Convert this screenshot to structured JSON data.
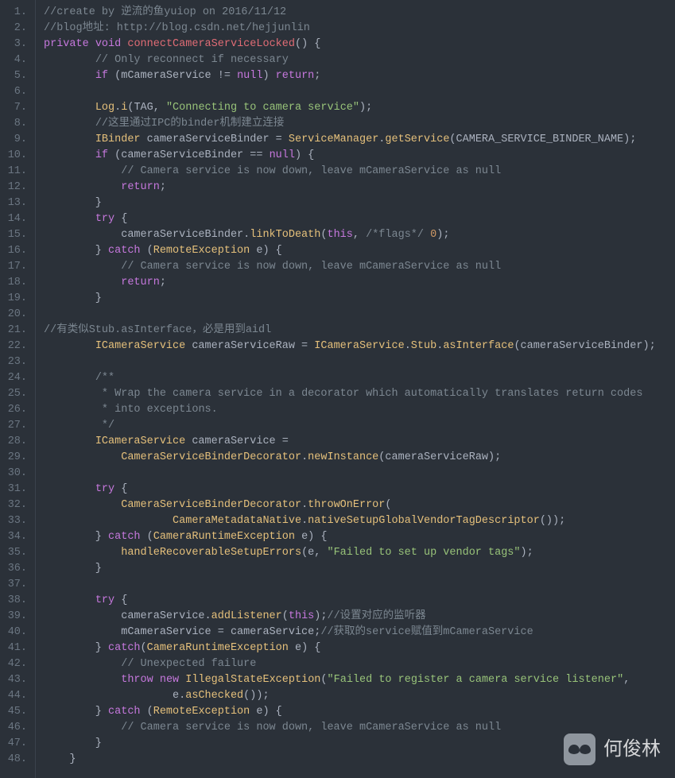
{
  "lineCount": 48,
  "lines": [
    [
      {
        "c": "cmt",
        "t": "//create by 逆流的鱼yuiop on 2016/11/12"
      }
    ],
    [
      {
        "c": "cmt",
        "t": "//blog地址: http://blog.csdn.net/hejjunlin"
      }
    ],
    [
      {
        "c": "kw",
        "t": "private"
      },
      {
        "c": "pun",
        "t": " "
      },
      {
        "c": "kw",
        "t": "void"
      },
      {
        "c": "pun",
        "t": " "
      },
      {
        "c": "fn",
        "t": "connectCameraServiceLocked"
      },
      {
        "c": "pun",
        "t": "() {"
      }
    ],
    [
      {
        "c": "pun",
        "t": "        "
      },
      {
        "c": "cmt",
        "t": "// Only reconnect if necessary"
      }
    ],
    [
      {
        "c": "pun",
        "t": "        "
      },
      {
        "c": "kw",
        "t": "if"
      },
      {
        "c": "pun",
        "t": " (mCameraService "
      },
      {
        "c": "op",
        "t": "!="
      },
      {
        "c": "pun",
        "t": " "
      },
      {
        "c": "kw",
        "t": "null"
      },
      {
        "c": "pun",
        "t": ") "
      },
      {
        "c": "kw",
        "t": "return"
      },
      {
        "c": "pun",
        "t": ";"
      }
    ],
    [
      {
        "c": "pun",
        "t": ""
      }
    ],
    [
      {
        "c": "pun",
        "t": "        "
      },
      {
        "c": "cls",
        "t": "Log"
      },
      {
        "c": "pun",
        "t": "."
      },
      {
        "c": "mth",
        "t": "i"
      },
      {
        "c": "pun",
        "t": "(TAG, "
      },
      {
        "c": "str",
        "t": "\"Connecting to camera service\""
      },
      {
        "c": "pun",
        "t": ");"
      }
    ],
    [
      {
        "c": "pun",
        "t": "        "
      },
      {
        "c": "cmt",
        "t": "//这里通过IPC的binder机制建立连接"
      }
    ],
    [
      {
        "c": "pun",
        "t": "        "
      },
      {
        "c": "cls",
        "t": "IBinder"
      },
      {
        "c": "pun",
        "t": " cameraServiceBinder = "
      },
      {
        "c": "cls",
        "t": "ServiceManager"
      },
      {
        "c": "pun",
        "t": "."
      },
      {
        "c": "mth",
        "t": "getService"
      },
      {
        "c": "pun",
        "t": "(CAMERA_SERVICE_BINDER_NAME);"
      }
    ],
    [
      {
        "c": "pun",
        "t": "        "
      },
      {
        "c": "kw",
        "t": "if"
      },
      {
        "c": "pun",
        "t": " (cameraServiceBinder "
      },
      {
        "c": "op",
        "t": "=="
      },
      {
        "c": "pun",
        "t": " "
      },
      {
        "c": "kw",
        "t": "null"
      },
      {
        "c": "pun",
        "t": ") {"
      }
    ],
    [
      {
        "c": "pun",
        "t": "            "
      },
      {
        "c": "cmt",
        "t": "// Camera service is now down, leave mCameraService as null"
      }
    ],
    [
      {
        "c": "pun",
        "t": "            "
      },
      {
        "c": "kw",
        "t": "return"
      },
      {
        "c": "pun",
        "t": ";"
      }
    ],
    [
      {
        "c": "pun",
        "t": "        }"
      }
    ],
    [
      {
        "c": "pun",
        "t": "        "
      },
      {
        "c": "kw",
        "t": "try"
      },
      {
        "c": "pun",
        "t": " {"
      }
    ],
    [
      {
        "c": "pun",
        "t": "            cameraServiceBinder."
      },
      {
        "c": "mth",
        "t": "linkToDeath"
      },
      {
        "c": "pun",
        "t": "("
      },
      {
        "c": "kw",
        "t": "this"
      },
      {
        "c": "pun",
        "t": ", "
      },
      {
        "c": "cmt",
        "t": "/*flags*/"
      },
      {
        "c": "pun",
        "t": " "
      },
      {
        "c": "num",
        "t": "0"
      },
      {
        "c": "pun",
        "t": ");"
      }
    ],
    [
      {
        "c": "pun",
        "t": "        } "
      },
      {
        "c": "kw",
        "t": "catch"
      },
      {
        "c": "pun",
        "t": " ("
      },
      {
        "c": "cls",
        "t": "RemoteException"
      },
      {
        "c": "pun",
        "t": " e) {"
      }
    ],
    [
      {
        "c": "pun",
        "t": "            "
      },
      {
        "c": "cmt",
        "t": "// Camera service is now down, leave mCameraService as null"
      }
    ],
    [
      {
        "c": "pun",
        "t": "            "
      },
      {
        "c": "kw",
        "t": "return"
      },
      {
        "c": "pun",
        "t": ";"
      }
    ],
    [
      {
        "c": "pun",
        "t": "        }"
      }
    ],
    [
      {
        "c": "pun",
        "t": ""
      }
    ],
    [
      {
        "c": "cmt",
        "t": "//有类似Stub.asInterface，必是用到aidl"
      }
    ],
    [
      {
        "c": "pun",
        "t": "        "
      },
      {
        "c": "cls",
        "t": "ICameraService"
      },
      {
        "c": "pun",
        "t": " cameraServiceRaw = "
      },
      {
        "c": "cls",
        "t": "ICameraService"
      },
      {
        "c": "pun",
        "t": "."
      },
      {
        "c": "cls",
        "t": "Stub"
      },
      {
        "c": "pun",
        "t": "."
      },
      {
        "c": "mth",
        "t": "asInterface"
      },
      {
        "c": "pun",
        "t": "(cameraServiceBinder);"
      }
    ],
    [
      {
        "c": "pun",
        "t": ""
      }
    ],
    [
      {
        "c": "pun",
        "t": "        "
      },
      {
        "c": "cmt",
        "t": "/**"
      }
    ],
    [
      {
        "c": "pun",
        "t": "         "
      },
      {
        "c": "cmt",
        "t": "* Wrap the camera service in a decorator which automatically translates return codes"
      }
    ],
    [
      {
        "c": "pun",
        "t": "         "
      },
      {
        "c": "cmt",
        "t": "* into exceptions."
      }
    ],
    [
      {
        "c": "pun",
        "t": "         "
      },
      {
        "c": "cmt",
        "t": "*/"
      }
    ],
    [
      {
        "c": "pun",
        "t": "        "
      },
      {
        "c": "cls",
        "t": "ICameraService"
      },
      {
        "c": "pun",
        "t": " cameraService ="
      }
    ],
    [
      {
        "c": "pun",
        "t": "            "
      },
      {
        "c": "cls",
        "t": "CameraServiceBinderDecorator"
      },
      {
        "c": "pun",
        "t": "."
      },
      {
        "c": "mth",
        "t": "newInstance"
      },
      {
        "c": "pun",
        "t": "(cameraServiceRaw);"
      }
    ],
    [
      {
        "c": "pun",
        "t": ""
      }
    ],
    [
      {
        "c": "pun",
        "t": "        "
      },
      {
        "c": "kw",
        "t": "try"
      },
      {
        "c": "pun",
        "t": " {"
      }
    ],
    [
      {
        "c": "pun",
        "t": "            "
      },
      {
        "c": "cls",
        "t": "CameraServiceBinderDecorator"
      },
      {
        "c": "pun",
        "t": "."
      },
      {
        "c": "mth",
        "t": "throwOnError"
      },
      {
        "c": "pun",
        "t": "("
      }
    ],
    [
      {
        "c": "pun",
        "t": "                    "
      },
      {
        "c": "cls",
        "t": "CameraMetadataNative"
      },
      {
        "c": "pun",
        "t": "."
      },
      {
        "c": "mth",
        "t": "nativeSetupGlobalVendorTagDescriptor"
      },
      {
        "c": "pun",
        "t": "());"
      }
    ],
    [
      {
        "c": "pun",
        "t": "        } "
      },
      {
        "c": "kw",
        "t": "catch"
      },
      {
        "c": "pun",
        "t": " ("
      },
      {
        "c": "cls",
        "t": "CameraRuntimeException"
      },
      {
        "c": "pun",
        "t": " e) {"
      }
    ],
    [
      {
        "c": "pun",
        "t": "            "
      },
      {
        "c": "mth",
        "t": "handleRecoverableSetupErrors"
      },
      {
        "c": "pun",
        "t": "(e, "
      },
      {
        "c": "str",
        "t": "\"Failed to set up vendor tags\""
      },
      {
        "c": "pun",
        "t": ");"
      }
    ],
    [
      {
        "c": "pun",
        "t": "        }"
      }
    ],
    [
      {
        "c": "pun",
        "t": ""
      }
    ],
    [
      {
        "c": "pun",
        "t": "        "
      },
      {
        "c": "kw",
        "t": "try"
      },
      {
        "c": "pun",
        "t": " {"
      }
    ],
    [
      {
        "c": "pun",
        "t": "            cameraService."
      },
      {
        "c": "mth",
        "t": "addListener"
      },
      {
        "c": "pun",
        "t": "("
      },
      {
        "c": "kw",
        "t": "this"
      },
      {
        "c": "pun",
        "t": ");"
      },
      {
        "c": "cmt",
        "t": "//设置对应的监听器"
      }
    ],
    [
      {
        "c": "pun",
        "t": "            mCameraService = cameraService;"
      },
      {
        "c": "cmt",
        "t": "//获取的service赋值到mCameraService"
      }
    ],
    [
      {
        "c": "pun",
        "t": "        } "
      },
      {
        "c": "kw",
        "t": "catch"
      },
      {
        "c": "pun",
        "t": "("
      },
      {
        "c": "cls",
        "t": "CameraRuntimeException"
      },
      {
        "c": "pun",
        "t": " e) {"
      }
    ],
    [
      {
        "c": "pun",
        "t": "            "
      },
      {
        "c": "cmt",
        "t": "// Unexpected failure"
      }
    ],
    [
      {
        "c": "pun",
        "t": "            "
      },
      {
        "c": "kw",
        "t": "throw"
      },
      {
        "c": "pun",
        "t": " "
      },
      {
        "c": "kw",
        "t": "new"
      },
      {
        "c": "pun",
        "t": " "
      },
      {
        "c": "cls",
        "t": "IllegalStateException"
      },
      {
        "c": "pun",
        "t": "("
      },
      {
        "c": "str",
        "t": "\"Failed to register a camera service listener\""
      },
      {
        "c": "pun",
        "t": ","
      }
    ],
    [
      {
        "c": "pun",
        "t": "                    e."
      },
      {
        "c": "mth",
        "t": "asChecked"
      },
      {
        "c": "pun",
        "t": "());"
      }
    ],
    [
      {
        "c": "pun",
        "t": "        } "
      },
      {
        "c": "kw",
        "t": "catch"
      },
      {
        "c": "pun",
        "t": " ("
      },
      {
        "c": "cls",
        "t": "RemoteException"
      },
      {
        "c": "pun",
        "t": " e) {"
      }
    ],
    [
      {
        "c": "pun",
        "t": "            "
      },
      {
        "c": "cmt",
        "t": "// Camera service is now down, leave mCameraService as null"
      }
    ],
    [
      {
        "c": "pun",
        "t": "        }"
      }
    ],
    [
      {
        "c": "pun",
        "t": "    }"
      }
    ]
  ],
  "watermark": "何俊林"
}
